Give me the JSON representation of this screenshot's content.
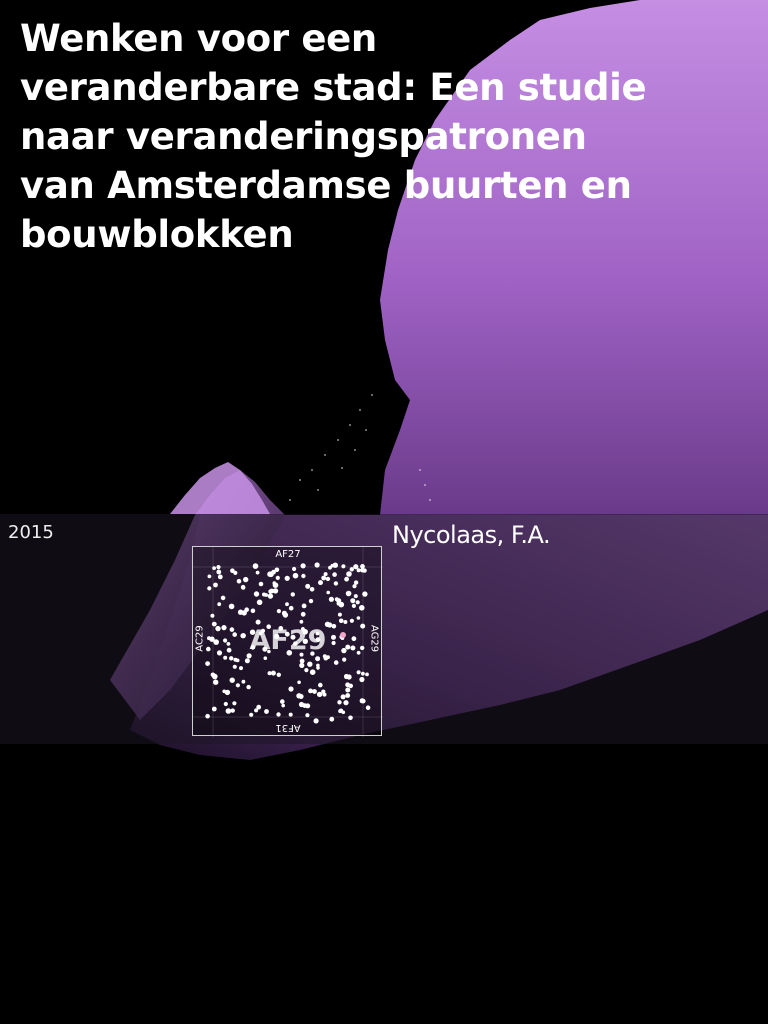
{
  "cover": {
    "title": "Wenken voor een veranderbare stad: Een studie naar veranderingspatronen van Amsterdamse buurten en bouwblokken",
    "year": "2015",
    "author": "Nycolaas, F.A."
  },
  "map": {
    "center_label": "AF29",
    "label_top": "AF27",
    "label_bottom": "AF31",
    "label_left": "AC29",
    "label_right": "AG29"
  },
  "colors": {
    "background": "#000000",
    "purple_light": "#c58ee3",
    "purple_mid": "#a56cc9",
    "purple_dark": "#3a1f52",
    "band": "#1e1624"
  }
}
